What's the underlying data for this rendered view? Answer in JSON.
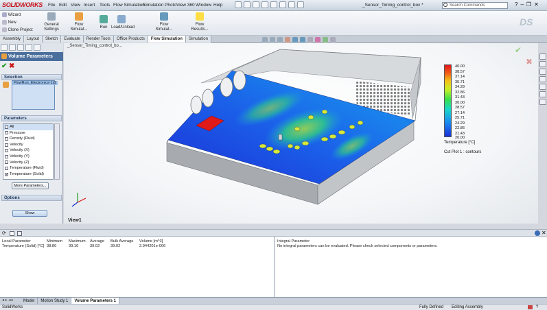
{
  "app": {
    "logo_text": "SOLIDWORKS",
    "menu": [
      "File",
      "Edit",
      "View",
      "Insert",
      "Tools",
      "Flow Simulation",
      "Simulation",
      "PhotoView 360",
      "Window",
      "Help"
    ],
    "doc_title": "_Sensor_Timing_control_box *",
    "search_placeholder": "Search Commands",
    "help_glyph": "?"
  },
  "ribbon": {
    "small_buttons": [
      "Wizard",
      "New",
      "Clone Project"
    ],
    "buttons": [
      "General Settings",
      "Flow Simulat...",
      "Run",
      "Load/Unload",
      "Flow Simulat...",
      "Flow Results..."
    ]
  },
  "tabs": [
    "Assembly",
    "Layout",
    "Sketch",
    "Evaluate",
    "Render Tools",
    "Office Products",
    "Flow Simulation",
    "Simulation"
  ],
  "active_tab": "Flow Simulation",
  "left_panel": {
    "header": "Volume Parameters",
    "selection_label": "Selection",
    "selection_item": "FlowRun_Electronics-1@",
    "parameters_label": "Parameters",
    "parameters": [
      {
        "label": "All",
        "checked": false
      },
      {
        "label": "Pressure",
        "checked": false
      },
      {
        "label": "Density (Fluid)",
        "checked": false
      },
      {
        "label": "Velocity",
        "checked": false
      },
      {
        "label": "Velocity (X)",
        "checked": false
      },
      {
        "label": "Velocity (Y)",
        "checked": false
      },
      {
        "label": "Velocity (Z)",
        "checked": false
      },
      {
        "label": "Temperature (Fluid)",
        "checked": false
      },
      {
        "label": "Temperature (Solid)",
        "checked": true
      }
    ],
    "more_button": "More Parameters...",
    "options_label": "Options",
    "show_button": "Show"
  },
  "viewport": {
    "tree_label": "_Sensor_Timing_control_bo...",
    "view_label": "View1"
  },
  "legend": {
    "values": [
      "40.00",
      "38.57",
      "37.14",
      "35.71",
      "34.29",
      "32.86",
      "31.43",
      "30.00",
      "28.57",
      "27.14",
      "25.71",
      "24.29",
      "22.86",
      "21.43",
      "20.00"
    ],
    "title": "Temperature [°C]",
    "cut_plot": "Cut Plot 1 : contours",
    "colors": {
      "max": "#e3131b",
      "min": "#1a2fd8"
    }
  },
  "results": {
    "local_headers": [
      "Local Parameter",
      "Minimum",
      "Maximum",
      "Average",
      "Bulk Average",
      "Volume [m^3]"
    ],
    "local_row": [
      "Temperature (Solid) [°C]",
      "38.80",
      "39.10",
      "39.02",
      "39.02",
      "2.944201e-006"
    ],
    "integral_header": "Integral Parameter",
    "integral_message": "No integral parameters can be evaluated. Please check selected components or parameters."
  },
  "bottom_tabs": [
    "Model",
    "Motion Study 1",
    "Volume Parameters 1"
  ],
  "active_bottom_tab": "Volume Parameters 1",
  "status": {
    "app": "SolidWorks",
    "state": "Fully Defined",
    "mode": "Editing Assembly"
  }
}
